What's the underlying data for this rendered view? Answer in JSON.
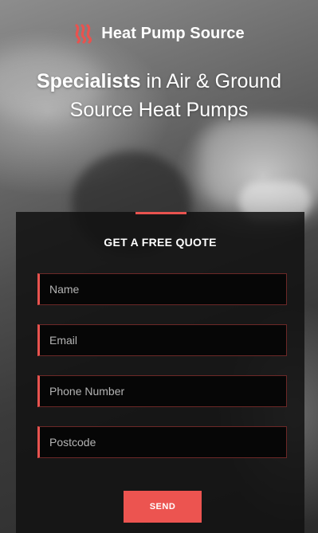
{
  "brand": {
    "name": "Heat Pump Source",
    "icon": "heat-waves-icon",
    "accent_color": "#e8534f"
  },
  "hero": {
    "title_bold": "Specialists",
    "title_rest_line1": " in Air & Ground",
    "title_line2": "Source Heat Pumps"
  },
  "quote_form": {
    "title": "GET A FREE QUOTE",
    "fields": {
      "name": {
        "placeholder": "Name",
        "value": ""
      },
      "email": {
        "placeholder": "Email",
        "value": ""
      },
      "phone": {
        "placeholder": "Phone Number",
        "value": ""
      },
      "postcode": {
        "placeholder": "Postcode",
        "value": ""
      }
    },
    "submit_label": "SEND",
    "button_color": "#ec5450"
  }
}
